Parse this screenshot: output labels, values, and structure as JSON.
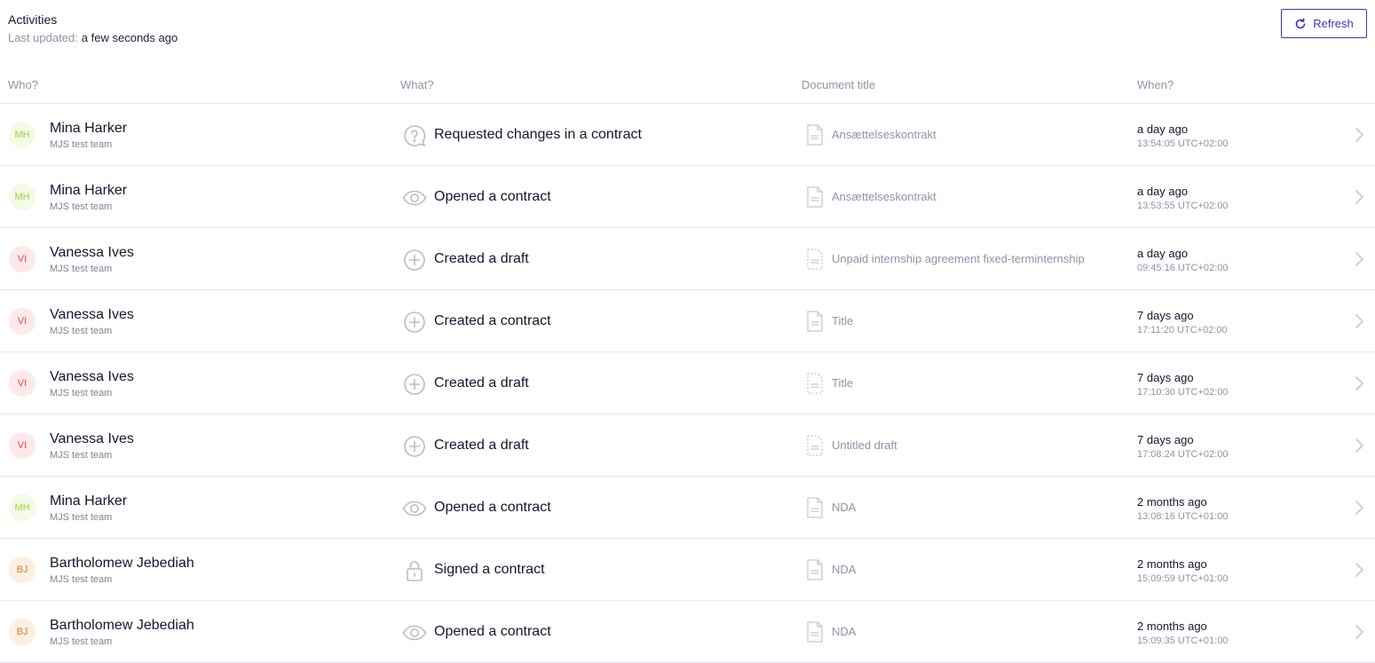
{
  "header": {
    "title": "Activities",
    "last_updated_label": "Last updated:",
    "last_updated_value": "a few seconds ago",
    "refresh_label": "Refresh"
  },
  "columns": {
    "who": "Who?",
    "what": "What?",
    "document": "Document title",
    "when": "When?"
  },
  "colors": {
    "accent": "#3b34c9",
    "avatar_mh_bg": "#f5fae6",
    "avatar_mh_fg": "#a6c840",
    "avatar_vi_bg": "#fde9ea",
    "avatar_vi_fg": "#e0454e",
    "avatar_bj_bg": "#fdefe4",
    "avatar_bj_fg": "#e07b30"
  },
  "rows": [
    {
      "initials": "MH",
      "name": "Mina Harker",
      "team": "MJS test team",
      "icon": "question-bubble-icon",
      "action": "Requested changes in a contract",
      "doc_icon": "document-icon",
      "document": "Ansættelseskontrakt",
      "when": "a day ago",
      "time": "13:54:05 UTC+02:00"
    },
    {
      "initials": "MH",
      "name": "Mina Harker",
      "team": "MJS test team",
      "icon": "eye-icon",
      "action": "Opened a contract",
      "doc_icon": "document-icon",
      "document": "Ansættelseskontrakt",
      "when": "a day ago",
      "time": "13:53:55 UTC+02:00"
    },
    {
      "initials": "VI",
      "name": "Vanessa Ives",
      "team": "MJS test team",
      "icon": "plus-circle-icon",
      "action": "Created a draft",
      "doc_icon": "draft-document-icon",
      "document": "Unpaid internship agreement fixed-terminternship",
      "when": "a day ago",
      "time": "09:45:16 UTC+02:00"
    },
    {
      "initials": "VI",
      "name": "Vanessa Ives",
      "team": "MJS test team",
      "icon": "plus-circle-icon",
      "action": "Created a contract",
      "doc_icon": "document-icon",
      "document": "Title",
      "when": "7 days ago",
      "time": "17:11:20 UTC+02:00"
    },
    {
      "initials": "VI",
      "name": "Vanessa Ives",
      "team": "MJS test team",
      "icon": "plus-circle-icon",
      "action": "Created a draft",
      "doc_icon": "draft-document-icon",
      "document": "Title",
      "when": "7 days ago",
      "time": "17:10:30 UTC+02:00"
    },
    {
      "initials": "VI",
      "name": "Vanessa Ives",
      "team": "MJS test team",
      "icon": "plus-circle-icon",
      "action": "Created a draft",
      "doc_icon": "draft-document-icon",
      "document": "Untitled draft",
      "when": "7 days ago",
      "time": "17:08:24 UTC+02:00"
    },
    {
      "initials": "MH",
      "name": "Mina Harker",
      "team": "MJS test team",
      "icon": "eye-icon",
      "action": "Opened a contract",
      "doc_icon": "document-icon",
      "document": "NDA",
      "when": "2 months ago",
      "time": "13:08:16 UTC+01:00"
    },
    {
      "initials": "BJ",
      "name": "Bartholomew Jebediah",
      "team": "MJS test team",
      "icon": "lock-icon",
      "action": "Signed a contract",
      "doc_icon": "document-icon",
      "document": "NDA",
      "when": "2 months ago",
      "time": "15:09:59 UTC+01:00"
    },
    {
      "initials": "BJ",
      "name": "Bartholomew Jebediah",
      "team": "MJS test team",
      "icon": "eye-icon",
      "action": "Opened a contract",
      "doc_icon": "document-icon",
      "document": "NDA",
      "when": "2 months ago",
      "time": "15:09:35 UTC+01:00"
    }
  ]
}
